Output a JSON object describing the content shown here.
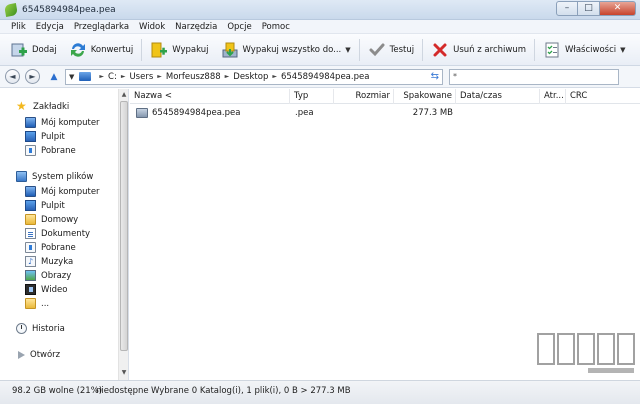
{
  "window": {
    "title": "6545894984pea.pea",
    "minimize": "–",
    "maximize": "□",
    "close": "✕"
  },
  "menu": [
    "Plik",
    "Edycja",
    "Przeglądarka",
    "Widok",
    "Narzędzia",
    "Opcje",
    "Pomoc"
  ],
  "toolbar": {
    "add": "Dodaj",
    "convert": "Konwertuj",
    "extract": "Wypakuj",
    "extract_all": "Wypakuj wszystko do...",
    "test": "Testuj",
    "delete": "Usuń z archiwum",
    "properties": "Właściwości",
    "dropdown_glyph": "▼"
  },
  "address": {
    "back": "◄",
    "forward": "►",
    "up": "▲",
    "dropdown": "▼",
    "crumbs": [
      "C:",
      "Users",
      "Morfeusz888",
      "Desktop",
      "6545894984pea.pea"
    ],
    "crumb_sep": "►",
    "refresh": "⇆",
    "filter_value": "*"
  },
  "sidebar": {
    "bookmarks_header": "Zakładki",
    "bookmarks": [
      "Mój komputer",
      "Pulpit",
      "Pobrane"
    ],
    "filesystem_header": "System plików",
    "filesystem": [
      "Mój komputer",
      "Pulpit",
      "Domowy",
      "Dokumenty",
      "Pobrane",
      "Muzyka",
      "Obrazy",
      "Wideo",
      "..."
    ],
    "history": "Historia",
    "open": "Otwórz",
    "scroll_up": "▲",
    "scroll_down": "▼"
  },
  "columns": {
    "name": "Nazwa <",
    "type": "Typ",
    "size": "Rozmiar",
    "packed": "Spakowane",
    "date": "Data/czas",
    "attr": "Atr...",
    "crc": "CRC"
  },
  "files": [
    {
      "name": "6545894984pea.pea",
      "type": ".pea",
      "size": "",
      "packed": "277.3 MB",
      "date": "",
      "attr": "",
      "crc": ""
    }
  ],
  "status": {
    "free": "98.2 GB wolne (21%)",
    "availability": "niedostępne",
    "selection": "Wybrane 0 Katalog(i), 1 plik(i), 0 B > 277.3 MB"
  },
  "colors": {
    "accent": "#2e7bd8",
    "titlebar": "#c9d9ec",
    "delete_red": "#d42a2a",
    "extract_yellow": "#f0c419"
  }
}
